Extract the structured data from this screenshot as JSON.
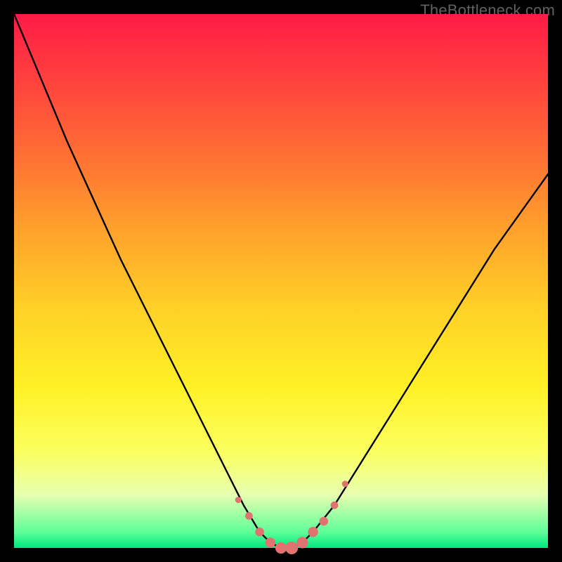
{
  "watermark": "TheBottleneck.com",
  "colors": {
    "gradient_top": "#ff1a47",
    "gradient_mid": "#fff126",
    "gradient_bottom": "#00e77e",
    "curve": "#000000",
    "dots": "#e0726f",
    "frame": "#000000"
  },
  "chart_data": {
    "type": "line",
    "title": "",
    "xlabel": "",
    "ylabel": "",
    "xlim": [
      0,
      100
    ],
    "ylim": [
      0,
      100
    ],
    "grid": false,
    "legend": false,
    "series": [
      {
        "name": "bottleneck-curve",
        "x": [
          0,
          5,
          10,
          15,
          20,
          25,
          30,
          35,
          40,
          43,
          46,
          48,
          50,
          52,
          54,
          56,
          60,
          65,
          70,
          75,
          80,
          85,
          90,
          95,
          100
        ],
        "y": [
          100,
          88,
          76,
          65,
          54,
          44,
          34,
          24,
          14,
          8,
          3,
          1,
          0,
          0,
          1,
          3,
          8,
          16,
          24,
          32,
          40,
          48,
          56,
          63,
          70
        ]
      }
    ],
    "highlight_points": {
      "name": "trough-dots",
      "x": [
        42,
        44,
        46,
        48,
        50,
        52,
        54,
        56,
        58,
        60,
        62
      ],
      "y": [
        9,
        6,
        3,
        1,
        0,
        0,
        1,
        3,
        5,
        8,
        12
      ]
    }
  }
}
